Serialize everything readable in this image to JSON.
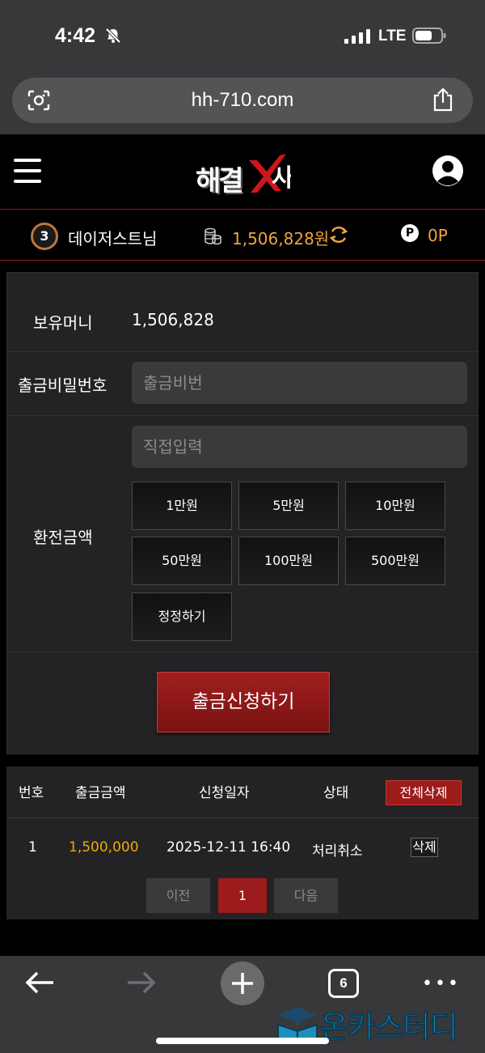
{
  "status_bar": {
    "time": "4:42",
    "network": "LTE"
  },
  "browser": {
    "url": "hh-710.com",
    "tab_count": "6"
  },
  "site": {
    "logo_text": "해결",
    "logo_mark_text": "사"
  },
  "user_bar": {
    "level": "3",
    "nickname": "데이저스트님",
    "balance": "1,506,828원",
    "point_badge": "P",
    "points": "0P"
  },
  "withdraw_form": {
    "balance_label": "보유머니",
    "balance_value": "1,506,828",
    "password_label": "출금비밀번호",
    "password_placeholder": "출금비번",
    "amount_label": "환전금액",
    "amount_placeholder": "직접입력",
    "amount_buttons": [
      "1만원",
      "5만원",
      "10만원",
      "50만원",
      "100만원",
      "500만원"
    ],
    "reset_label": "정정하기",
    "submit_label": "출금신청하기"
  },
  "history": {
    "columns": [
      "번호",
      "출금금액",
      "신청일자",
      "상태"
    ],
    "delete_all_label": "전체삭제",
    "rows": [
      {
        "no": "1",
        "amount": "1,500,000",
        "date": "2025-12-11 16:40",
        "status": "처리취소",
        "action": "삭제"
      }
    ],
    "pagination": {
      "prev": "이전",
      "current": "1",
      "next": "다음"
    }
  },
  "watermark": {
    "text": "온카스터디"
  },
  "colors": {
    "accent_red": "#9c1b1b",
    "money_orange": "#f2a33a",
    "amount_gold": "#f2a900",
    "panel_bg": "#232325"
  }
}
